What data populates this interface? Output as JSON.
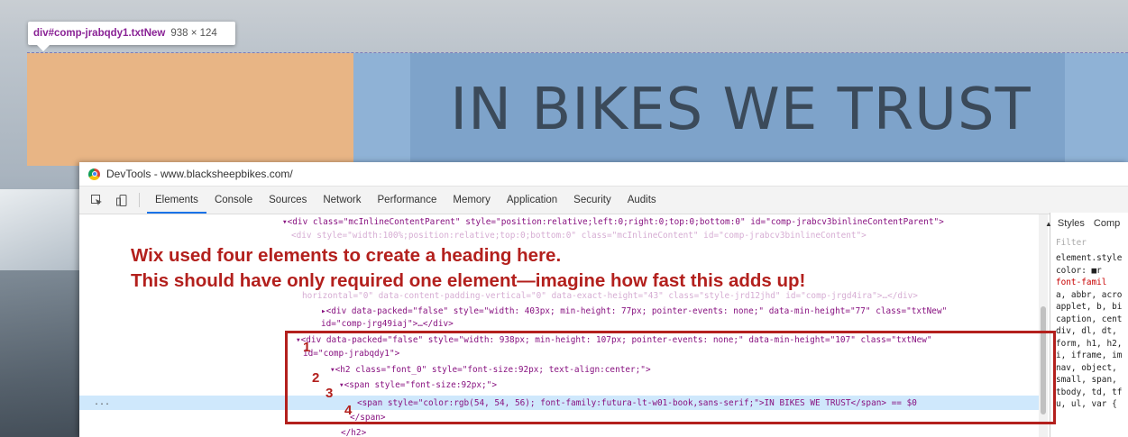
{
  "tooltip": {
    "selector": "div#comp-jrabqdy1.txtNew",
    "size": "938 × 124"
  },
  "page_heading": "IN BIKES WE TRUST",
  "devtools": {
    "title": "DevTools - www.blacksheepbikes.com/",
    "tabs": [
      "Elements",
      "Console",
      "Sources",
      "Network",
      "Performance",
      "Memory",
      "Application",
      "Security",
      "Audits"
    ],
    "active_tab": "Elements",
    "lines": [
      "▾<div class=\"mcInlineContentParent\" style=\"position:relative;left:0;right:0;top:0;bottom:0\" id=\"comp-jrabcv3binlineContentParent\">",
      "<div style=\"width:100%;position:relative;top:0;bottom:0\" class=\"mcInlineContent\" id=\"comp-jrabcv3binlineContent\">",
      "horizontal=\"0\" data-content-padding-vertical=\"0\" data-exact-height=\"43\" class=\"style-jrd12jhd\" id=\"comp-jrgd4ira\">…</div>",
      "▸<div data-packed=\"false\" style=\"width: 403px; min-height: 77px; pointer-events: none;\" data-min-height=\"77\" class=\"txtNew\"",
      "id=\"comp-jrg49iaj\">…</div>",
      "▾<div data-packed=\"false\" style=\"width: 938px; min-height: 107px; pointer-events: none;\" data-min-height=\"107\" class=\"txtNew\"",
      "id=\"comp-jrabqdy1\">",
      "▾<h2 class=\"font_0\" style=\"font-size:92px; text-align:center;\">",
      "▾<span style=\"font-size:92px;\">",
      "<span style=\"color:rgb(54, 54, 56); font-family:futura-lt-w01-book,sans-serif;\">IN BIKES WE TRUST</span> == $0",
      "</span>",
      "</h2>"
    ],
    "ellipsis": "...",
    "side_panel": {
      "tabs": [
        "Styles",
        "Comp"
      ],
      "filter": "Filter",
      "lines": [
        "element.style",
        "color: ■r",
        "font-famil",
        "",
        "",
        "",
        "a, abbr, acro",
        "applet, b, bi",
        "caption, cent",
        "div, dl, dt,",
        "form, h1, h2,",
        "i, iframe, im",
        "nav, object,",
        "small, span,",
        "tbody, td, tf",
        "u, ul, var {"
      ]
    }
  },
  "annotation": {
    "line1": "Wix used four elements to create a heading here.",
    "line2": "This should have only required one element—imagine how fast this adds up!",
    "numbers": [
      "1",
      "2",
      "3",
      "4"
    ]
  },
  "colors": {
    "annotation_red": "#b3201d",
    "highlight_margin": "#e8b585",
    "highlight_content": "#8fb2d6"
  }
}
